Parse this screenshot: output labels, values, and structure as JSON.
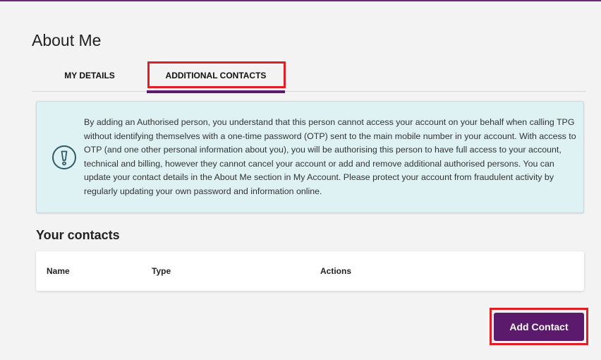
{
  "page": {
    "title": "About Me"
  },
  "tabs": [
    {
      "label": "MY DETAILS",
      "active": false
    },
    {
      "label": "ADDITIONAL CONTACTS",
      "active": true
    }
  ],
  "notice": {
    "icon": "exclamation-circle-icon",
    "text": "By adding an Authorised person, you understand that this person cannot access your account on your behalf when calling TPG without identifying themselves with a one-time password (OTP) sent to the main mobile number in your account. With access to OTP (and one other personal information about you), you will be authorising this person to have full access to your account, technical and billing, however they cannot cancel your account or add and remove additional authorised persons. You can update your contact details in the About Me section in My Account. Please protect your account from fraudulent activity by regularly updating your own password and information online."
  },
  "contacts": {
    "title": "Your contacts",
    "columns": [
      "Name",
      "Type",
      "Actions"
    ],
    "add_label": "Add Contact"
  },
  "colors": {
    "brand": "#5b1a6b",
    "highlight": "#e01e26",
    "notice_bg": "#def1f3"
  }
}
